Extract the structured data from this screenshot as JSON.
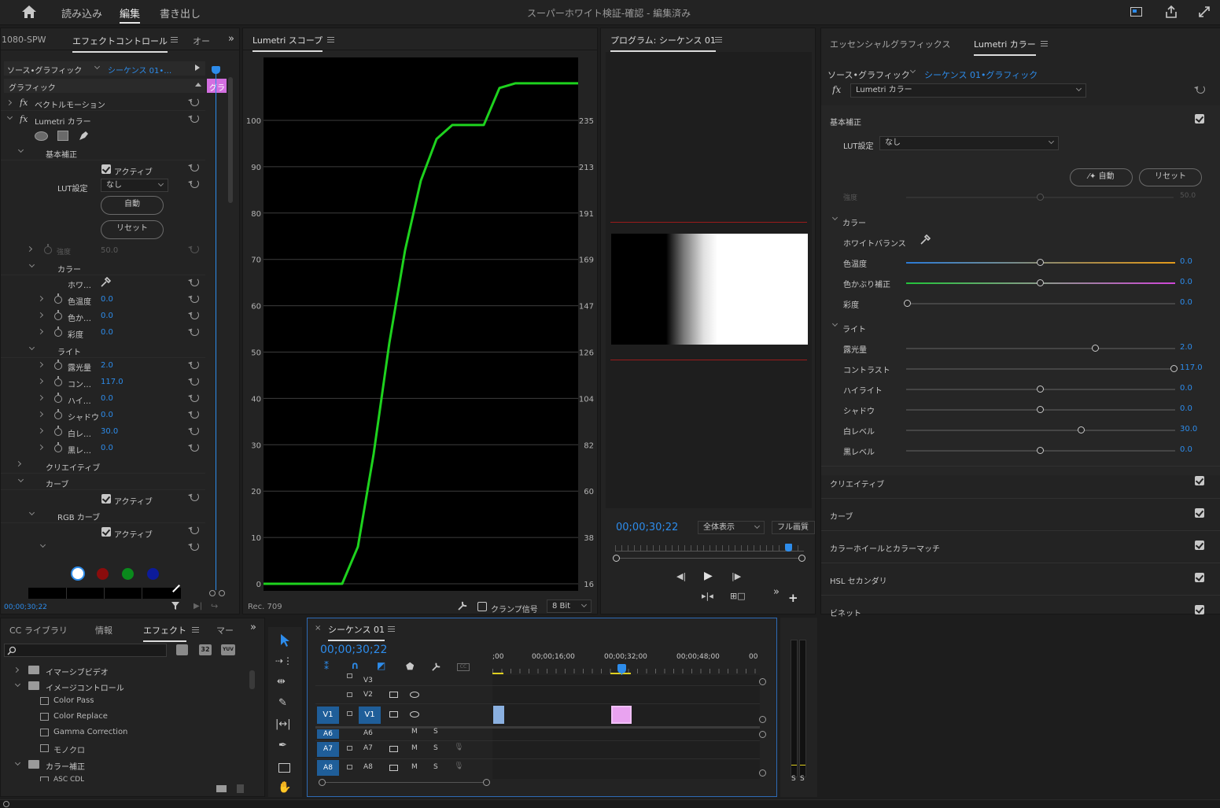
{
  "topbar": {
    "nav": [
      "読み込み",
      "編集",
      "書き出し"
    ],
    "title": "スーパーホワイト検証-確認",
    "title_suffix": " - 編集済み"
  },
  "effect_controls": {
    "tab_left": "1080-SPW",
    "tab_active": "エフェクトコントロール",
    "tab_right": "オー",
    "source": "ソース•グラフィック",
    "sequence": "シーケンス 01•…",
    "clip_thumb": "グラ",
    "section": "グラフィック",
    "vector_motion": "ベクトルモーション",
    "lumetri": "Lumetri カラー",
    "basic": "基本補正",
    "active": "アクティブ",
    "lut_label": "LUT設定",
    "lut_value": "なし",
    "auto": "自動",
    "reset": "リセット",
    "intensity": "強度",
    "intensity_val": "50.0",
    "color": "カラー",
    "wb": "ホワ…",
    "temp": "色温度",
    "temp_val": "0.0",
    "tint": "色か…",
    "tint_val": "0.0",
    "sat": "彩度",
    "sat_val": "0.0",
    "light": "ライト",
    "exposure": "露光量",
    "exposure_val": "2.0",
    "contrast": "コン…",
    "contrast_val": "117.0",
    "highlight": "ハイ…",
    "highlight_val": "0.0",
    "shadow": "シャドウ",
    "shadow_val": "0.0",
    "white": "白レ…",
    "white_val": "30.0",
    "black": "黒レ…",
    "black_val": "0.0",
    "creative": "クリエイティブ",
    "curve": "カーブ",
    "rgb_curve": "RGB カーブ",
    "timecode": "00;00;30;22"
  },
  "scope": {
    "title": "Lumetri スコープ",
    "footer_left": "Rec. 709",
    "clamp": "クランプ信号",
    "bit": "8 Bit"
  },
  "chart_data": {
    "type": "line",
    "title": "",
    "xlabel": "",
    "ylabel": "",
    "ylim": [
      0,
      108
    ],
    "y_ticks_left": [
      0,
      10,
      20,
      30,
      40,
      50,
      60,
      70,
      80,
      90,
      100
    ],
    "y_ticks_right": [
      16,
      38,
      60,
      82,
      104,
      126,
      147,
      169,
      191,
      213,
      235
    ],
    "series": [
      {
        "color": "#1ed21e",
        "x": [
          0,
          0.25,
          0.3,
          0.35,
          0.4,
          0.45,
          0.5,
          0.55,
          0.6,
          0.65,
          0.7,
          0.75,
          0.8,
          1.0
        ],
        "values": [
          0,
          0,
          8,
          28,
          52,
          72,
          87,
          96,
          99,
          99,
          99,
          107,
          108,
          108
        ]
      }
    ]
  },
  "program": {
    "title": "プログラム: シーケンス 01",
    "timecode": "00;00;30;22",
    "zoom": "全体表示",
    "quality": "フル画質"
  },
  "lumetri_panel": {
    "tab1": "エッセンシャルグラフィックス",
    "tab2": "Lumetri カラー",
    "source": "ソース•グラフィック",
    "sequence": "シーケンス 01•グラフィック",
    "effect": "Lumetri カラー",
    "basic": "基本補正",
    "lut_label": "LUT設定",
    "lut_value": "なし",
    "auto": "自動",
    "reset": "リセット",
    "intensity": "強度",
    "intensity_val": "50.0",
    "color": "カラー",
    "wb": "ホワイトバランス",
    "temp": "色温度",
    "temp_val": "0.0",
    "tint": "色かぶり補正",
    "tint_val": "0.0",
    "sat": "彩度",
    "sat_val": "0.0",
    "light": "ライト",
    "exposure": "露光量",
    "exposure_val": "2.0",
    "contrast": "コントラスト",
    "contrast_val": "117.0",
    "highlight": "ハイライト",
    "highlight_val": "0.0",
    "shadow": "シャドウ",
    "shadow_val": "0.0",
    "white": "白レベル",
    "white_val": "30.0",
    "black": "黒レベル",
    "black_val": "0.0",
    "creative": "クリエイティブ",
    "curve": "カーブ",
    "wheels": "カラーホイールとカラーマッチ",
    "hsl": "HSL セカンダリ",
    "vignette": "ビネット"
  },
  "project": {
    "tabs": [
      "CC ライブラリ",
      "情報",
      "エフェクト",
      "マー"
    ],
    "items": [
      "イマーシブビデオ",
      "イメージコントロール",
      "Color Pass",
      "Color Replace",
      "Gamma Correction",
      "モノクロ",
      "カラー補正",
      "ASC CDL"
    ]
  },
  "timeline": {
    "title": "シーケンス 01",
    "timecode": "00;00;30;22",
    "ruler": [
      ";00",
      "00;00;16;00",
      "00;00;32;00",
      "00;00;48;00",
      "00"
    ],
    "tracks": [
      "V3",
      "V2",
      "V1",
      "A6",
      "A7",
      "A8"
    ],
    "src_v1": "V1",
    "src_a": [
      "A6",
      "A7",
      "A8"
    ]
  }
}
